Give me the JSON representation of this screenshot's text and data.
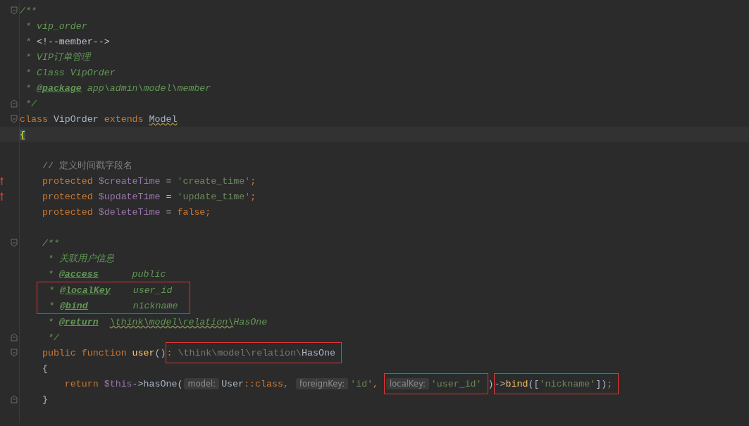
{
  "editor": {
    "lines": [
      {
        "kind": "code",
        "fold_start": true,
        "segments": [
          {
            "kind": "code",
            "tokens": [
              {
                "kind": "doc",
                "text": "/**"
              }
            ]
          }
        ]
      },
      {
        "kind": "code",
        "segments": [
          {
            "kind": "code",
            "tokens": [
              {
                "kind": "doc",
                "text": " * vip_order"
              }
            ]
          }
        ]
      },
      {
        "kind": "code",
        "segments": [
          {
            "kind": "code",
            "tokens": [
              {
                "kind": "doc",
                "text": " * "
              },
              {
                "kind": "markup",
                "text": "<!--member-->"
              }
            ]
          }
        ]
      },
      {
        "kind": "code",
        "segments": [
          {
            "kind": "code",
            "tokens": [
              {
                "kind": "doc",
                "text": " * VIP订单管理"
              }
            ]
          }
        ]
      },
      {
        "kind": "code",
        "segments": [
          {
            "kind": "code",
            "tokens": [
              {
                "kind": "doc",
                "text": " * Class VipOrder"
              }
            ]
          }
        ]
      },
      {
        "kind": "code",
        "segments": [
          {
            "kind": "code",
            "tokens": [
              {
                "kind": "doc",
                "text": " * "
              },
              {
                "kind": "doctag",
                "text": "@package"
              },
              {
                "kind": "doc",
                "text": " app\\admin\\model\\member"
              }
            ]
          }
        ]
      },
      {
        "kind": "code",
        "fold_end": true,
        "segments": [
          {
            "kind": "code",
            "tokens": [
              {
                "kind": "doc",
                "text": " */"
              }
            ]
          }
        ]
      },
      {
        "kind": "code",
        "fold_start": true,
        "segments": [
          {
            "kind": "code",
            "tokens": [
              {
                "kind": "keyword",
                "text": "class "
              },
              {
                "kind": "plain",
                "text": "VipOrder "
              },
              {
                "kind": "keyword",
                "text": "extends "
              },
              {
                "kind": "warn",
                "text": "Model"
              }
            ]
          }
        ]
      },
      {
        "kind": "code",
        "current": true,
        "segments": [
          {
            "kind": "code",
            "tokens": [
              {
                "kind": "brace-match",
                "text": "{"
              }
            ]
          }
        ]
      },
      {
        "kind": "blank"
      },
      {
        "kind": "code",
        "segments": [
          {
            "kind": "code",
            "tokens": [
              {
                "kind": "comment",
                "text": "    // 定义时间戳字段名"
              }
            ]
          }
        ]
      },
      {
        "kind": "code",
        "overridden": true,
        "segments": [
          {
            "kind": "code",
            "tokens": [
              {
                "kind": "keyword",
                "text": "    protected "
              },
              {
                "kind": "var",
                "text": "$createTime"
              },
              {
                "kind": "plain",
                "text": " = "
              },
              {
                "kind": "string",
                "text": "'create_time'"
              },
              {
                "kind": "keyword",
                "text": ";"
              }
            ]
          }
        ]
      },
      {
        "kind": "code",
        "overridden": true,
        "segments": [
          {
            "kind": "code",
            "tokens": [
              {
                "kind": "keyword",
                "text": "    protected "
              },
              {
                "kind": "var",
                "text": "$updateTime"
              },
              {
                "kind": "plain",
                "text": " = "
              },
              {
                "kind": "string",
                "text": "'update_time'"
              },
              {
                "kind": "keyword",
                "text": ";"
              }
            ]
          }
        ]
      },
      {
        "kind": "code",
        "segments": [
          {
            "kind": "code",
            "tokens": [
              {
                "kind": "keyword",
                "text": "    protected "
              },
              {
                "kind": "var",
                "text": "$deleteTime"
              },
              {
                "kind": "plain",
                "text": " = "
              },
              {
                "kind": "keyword",
                "text": "false;"
              }
            ]
          }
        ]
      },
      {
        "kind": "blank"
      },
      {
        "kind": "code",
        "fold_start": true,
        "segments": [
          {
            "kind": "code",
            "tokens": [
              {
                "kind": "doc",
                "text": "    /**"
              }
            ]
          }
        ]
      },
      {
        "kind": "code",
        "segments": [
          {
            "kind": "code",
            "tokens": [
              {
                "kind": "doc",
                "text": "     * 关联用户信息"
              }
            ]
          }
        ]
      },
      {
        "kind": "code",
        "segments": [
          {
            "kind": "code",
            "tokens": [
              {
                "kind": "doc",
                "text": "     * "
              },
              {
                "kind": "doctag",
                "text": "@access"
              },
              {
                "kind": "doc",
                "text": "      public"
              }
            ]
          }
        ]
      },
      {
        "kind": "box-group",
        "lines": [
          {
            "segments": [
              {
                "kind": "code",
                "tokens": [
                  {
                    "kind": "doc",
                    "text": "  * "
                  },
                  {
                    "kind": "doctag",
                    "text": "@localKey"
                  },
                  {
                    "kind": "doc",
                    "text": "    user_id"
                  }
                ]
              }
            ]
          },
          {
            "segments": [
              {
                "kind": "code",
                "tokens": [
                  {
                    "kind": "doc",
                    "text": "  * "
                  },
                  {
                    "kind": "doctag",
                    "text": "@bind"
                  },
                  {
                    "kind": "doc",
                    "text": "        nickname"
                  }
                ]
              }
            ]
          }
        ]
      },
      {
        "kind": "code",
        "segments": [
          {
            "kind": "code",
            "tokens": [
              {
                "kind": "doc",
                "text": "     * "
              },
              {
                "kind": "doctag",
                "text": "@return"
              },
              {
                "kind": "doc-warn",
                "text": "  \\think\\model\\relation\\"
              },
              {
                "kind": "doc",
                "text": "HasOne"
              }
            ]
          }
        ]
      },
      {
        "kind": "code",
        "fold_end": true,
        "segments": [
          {
            "kind": "code",
            "tokens": [
              {
                "kind": "doc",
                "text": "     */"
              }
            ]
          }
        ]
      },
      {
        "kind": "code",
        "fold_start": true,
        "segments": [
          {
            "kind": "code",
            "tokens": [
              {
                "kind": "keyword",
                "text": "    public function "
              },
              {
                "kind": "funcdef",
                "text": "user"
              },
              {
                "kind": "plain",
                "text": "()"
              }
            ]
          },
          {
            "kind": "box",
            "segments": [
              {
                "kind": "code",
                "tokens": [
                  {
                    "kind": "keyword",
                    "text": ":"
                  },
                  {
                    "kind": "muted",
                    "text": " \\think\\model\\relation\\"
                  },
                  {
                    "kind": "plain",
                    "text": "HasOne"
                  }
                ]
              }
            ]
          }
        ]
      },
      {
        "kind": "code",
        "segments": [
          {
            "kind": "code",
            "tokens": [
              {
                "kind": "plain",
                "text": "    {"
              }
            ]
          }
        ]
      },
      {
        "kind": "code",
        "segments": [
          {
            "kind": "code",
            "tokens": [
              {
                "kind": "keyword",
                "text": "        return "
              },
              {
                "kind": "var",
                "text": "$this"
              },
              {
                "kind": "plain",
                "text": "->hasOne("
              }
            ]
          },
          {
            "kind": "hint",
            "text": "model:"
          },
          {
            "kind": "code",
            "tokens": [
              {
                "kind": "plain",
                "text": "User"
              },
              {
                "kind": "keyword",
                "text": "::class, "
              }
            ]
          },
          {
            "kind": "hint",
            "text": "foreignKey:"
          },
          {
            "kind": "code",
            "tokens": [
              {
                "kind": "string",
                "text": "'id'"
              },
              {
                "kind": "keyword",
                "text": ", "
              }
            ]
          },
          {
            "kind": "box",
            "segments": [
              {
                "kind": "hint",
                "text": "localKey:"
              },
              {
                "kind": "code",
                "tokens": [
                  {
                    "kind": "string",
                    "text": "'user_id'"
                  }
                ]
              }
            ]
          },
          {
            "kind": "code",
            "tokens": [
              {
                "kind": "plain",
                "text": ")"
              }
            ]
          },
          {
            "kind": "box",
            "segments": [
              {
                "kind": "code",
                "tokens": [
                  {
                    "kind": "plain",
                    "text": "->"
                  },
                  {
                    "kind": "funcdef",
                    "text": "bind"
                  },
                  {
                    "kind": "plain",
                    "text": "(["
                  },
                  {
                    "kind": "string",
                    "text": "'nickname'"
                  },
                  {
                    "kind": "plain",
                    "text": "])"
                  },
                  {
                    "kind": "keyword",
                    "text": ";"
                  }
                ]
              }
            ]
          }
        ]
      },
      {
        "kind": "code",
        "fold_end": true,
        "segments": [
          {
            "kind": "code",
            "tokens": [
              {
                "kind": "plain",
                "text": "    }"
              }
            ]
          }
        ]
      },
      {
        "kind": "blank"
      }
    ]
  }
}
